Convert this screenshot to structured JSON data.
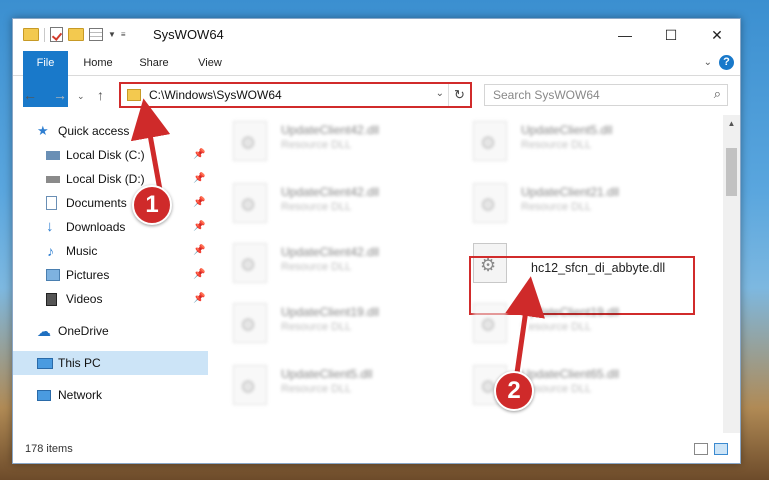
{
  "window": {
    "title": "SysWOW64"
  },
  "ribbon": {
    "tabs": [
      "File",
      "Home",
      "Share",
      "View"
    ],
    "help": "?"
  },
  "address": {
    "path": "C:\\Windows\\SysWOW64"
  },
  "search": {
    "placeholder": "Search SysWOW64"
  },
  "nav": {
    "items": [
      {
        "label": "Quick access"
      },
      {
        "label": "Local Disk (C:)"
      },
      {
        "label": "Local Disk (D:)"
      },
      {
        "label": "Documents"
      },
      {
        "label": "Downloads"
      },
      {
        "label": "Music"
      },
      {
        "label": "Pictures"
      },
      {
        "label": "Videos"
      },
      {
        "label": "OneDrive"
      },
      {
        "label": "This PC"
      },
      {
        "label": "Network"
      }
    ]
  },
  "files": [
    {
      "name": "UpdateClient42.dll",
      "type": "Resource DLL"
    },
    {
      "name": "UpdateClient5.dll",
      "type": "Resource DLL"
    },
    {
      "name": "UpdateClient42.dll",
      "type": "Resource DLL"
    },
    {
      "name": "UpdateClient21.dll",
      "type": "Resource DLL"
    },
    {
      "name": "UpdateClient42.dll",
      "type": "Resource DLL"
    },
    {
      "name": "hc12_sfcn_di_abbyte.dll",
      "type": ""
    },
    {
      "name": "UpdateClient19.dll",
      "type": "Resource DLL"
    },
    {
      "name": "UpdateClient19.dll",
      "type": "Resource DLL"
    },
    {
      "name": "UpdateClient5.dll",
      "type": "Resource DLL"
    },
    {
      "name": "UpdateClient65.dll",
      "type": "Resource DLL"
    }
  ],
  "status": {
    "count": "178 items"
  },
  "badges": [
    "1",
    "2"
  ],
  "colors": {
    "accent": "#1979ca",
    "highlight": "#d12b2b",
    "selected": "#cce4f7"
  }
}
